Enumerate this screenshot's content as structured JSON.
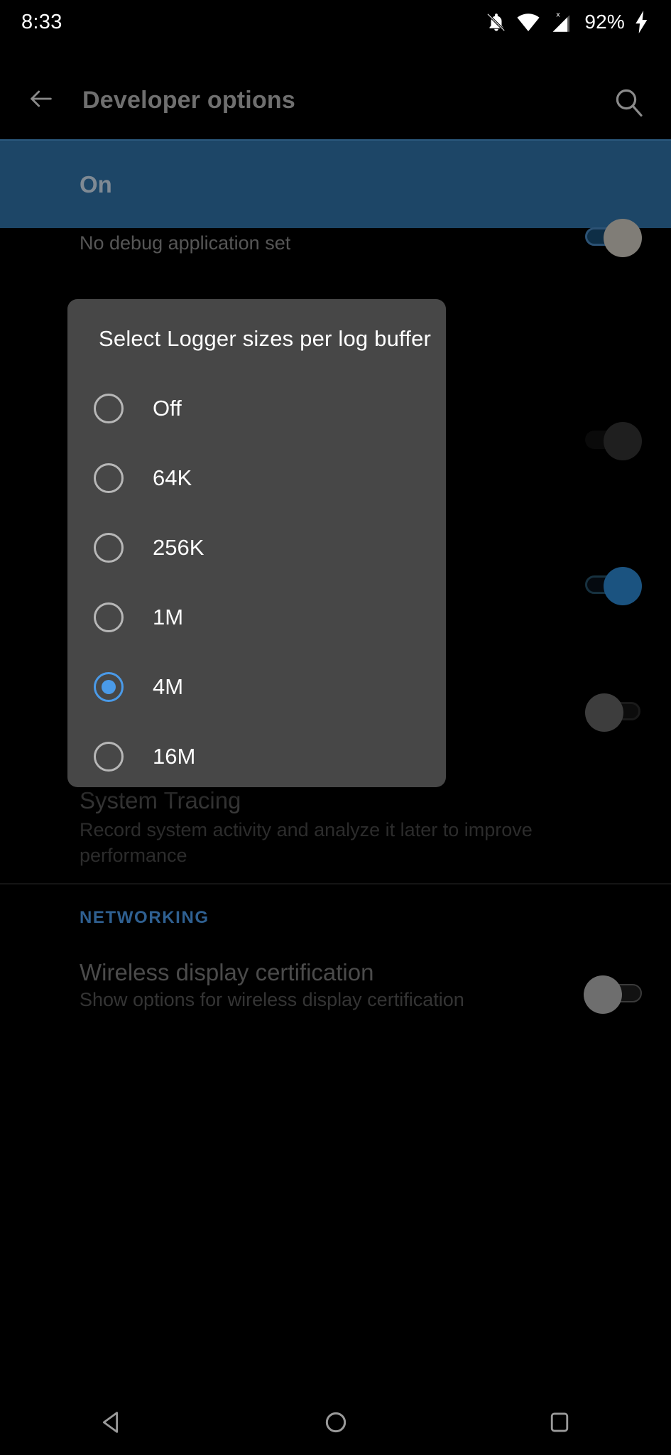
{
  "status_bar": {
    "clock": "8:33",
    "battery_percent": "92%",
    "icons": [
      "notifications-off-icon",
      "wifi-icon",
      "signal-no-sim-icon",
      "battery-charging-icon"
    ]
  },
  "app_bar": {
    "back_icon": "arrow-back-icon",
    "title": "Developer options",
    "search_icon": "search-icon"
  },
  "on_banner": {
    "label": "On",
    "toggle_state": "on",
    "background_color": "#1d4667"
  },
  "background_list": {
    "debug_app_sub": "No debug application set",
    "system_tracing": {
      "title": "System Tracing",
      "sub": "Record system activity and analyze it later to improve performance"
    },
    "networking_header": "NETWORKING",
    "wireless_display": {
      "title": "Wireless display certification",
      "sub": "Show options for wireless display certification",
      "toggle_state": "off"
    }
  },
  "dialog": {
    "title": "Select Logger sizes per log buffer",
    "selected_value": "4M",
    "accent_color": "#4a9ae8",
    "background_color": "#474747",
    "options": [
      {
        "label": "Off",
        "selected": false
      },
      {
        "label": "64K",
        "selected": false
      },
      {
        "label": "256K",
        "selected": false
      },
      {
        "label": "1M",
        "selected": false
      },
      {
        "label": "4M",
        "selected": true
      },
      {
        "label": "16M",
        "selected": false
      }
    ]
  },
  "nav_bar": {
    "back": "nav-back-icon",
    "home": "nav-home-icon",
    "recents": "nav-recents-icon"
  }
}
